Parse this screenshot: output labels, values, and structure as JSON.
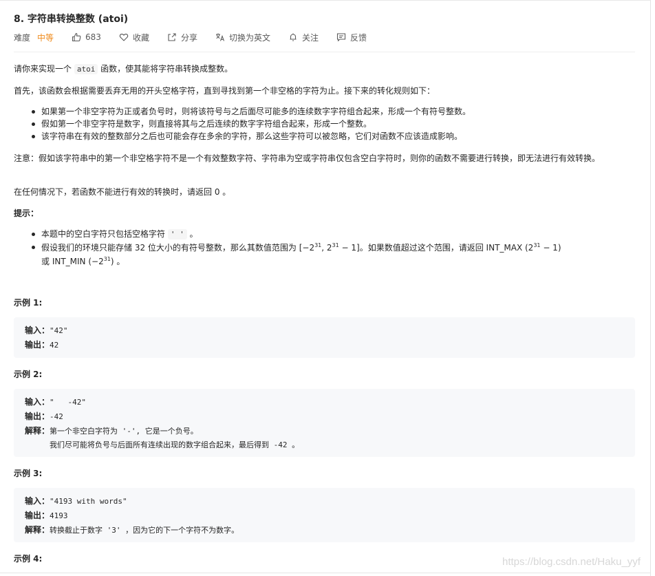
{
  "problem": {
    "title": "8. 字符串转换整数 (atoi)",
    "difficulty_label": "难度",
    "difficulty": "中等",
    "likes": "683",
    "favorite_label": "收藏",
    "share_label": "分享",
    "translate_label": "切换为英文",
    "follow_label": "关注",
    "feedback_label": "反馈"
  },
  "description": {
    "p1_pre": "请你来实现一个 ",
    "p1_code": "atoi",
    "p1_post": " 函数，使其能将字符串转换成整数。",
    "p2": "首先，该函数会根据需要丢弃无用的开头空格字符，直到寻找到第一个非空格的字符为止。接下来的转化规则如下：",
    "rules": [
      "如果第一个非空字符为正或者负号时，则将该符号与之后面尽可能多的连续数字字符组合起来，形成一个有符号整数。",
      "假如第一个非空字符是数字，则直接将其与之后连续的数字字符组合起来，形成一个整数。",
      "该字符串在有效的整数部分之后也可能会存在多余的字符，那么这些字符可以被忽略，它们对函数不应该造成影响。"
    ],
    "note": "注意：假如该字符串中的第一个非空格字符不是一个有效整数字符、字符串为空或字符串仅包含空白字符时，则你的函数不需要进行转换，即无法进行有效转换。",
    "p4": "在任何情况下，若函数不能进行有效的转换时，请返回 0 。",
    "hint_title": "提示：",
    "hint1_pre": "本题中的空白字符只包括空格字符 ",
    "hint1_code": "' '",
    "hint1_post": " 。",
    "hint2_a": "假设我们的环境只能存储 32 位大小的有符号整数，那么其数值范围为 [−2",
    "hint2_sup1": "31",
    "hint2_b": ",  2",
    "hint2_sup2": "31",
    "hint2_c": " − 1]。如果数值超过这个范围，请返回  INT_MAX (2",
    "hint2_sup3": "31",
    "hint2_d": " − 1)",
    "hint2_e": "或 INT_MIN (−2",
    "hint2_sup4": "31",
    "hint2_f": ") 。"
  },
  "examples": [
    {
      "title": "示例 1:",
      "input_label": "输入：",
      "input": "\"42\"",
      "output_label": "输出：",
      "output": "42"
    },
    {
      "title": "示例 2:",
      "input_label": "输入：",
      "input": "\"   -42\"",
      "output_label": "输出：",
      "output": "-42",
      "explain_label": "解释：",
      "explain1": "第一个非空白字符为 '-', 它是一个负号。",
      "explain2": "我们尽可能将负号与后面所有连续出现的数字组合起来，最后得到 -42 。"
    },
    {
      "title": "示例 3:",
      "input_label": "输入：",
      "input": "\"4193 with words\"",
      "output_label": "输出：",
      "output": "4193",
      "explain_label": "解释：",
      "explain1": "转换截止于数字 '3' ，因为它的下一个字符不为数字。"
    },
    {
      "title": "示例 4:"
    }
  ],
  "watermark": "https://blog.csdn.net/Haku_yyf",
  "colors": {
    "difficulty_medium": "#ef8b1c",
    "code_bg": "#f7f8fa",
    "text": "#262626"
  }
}
